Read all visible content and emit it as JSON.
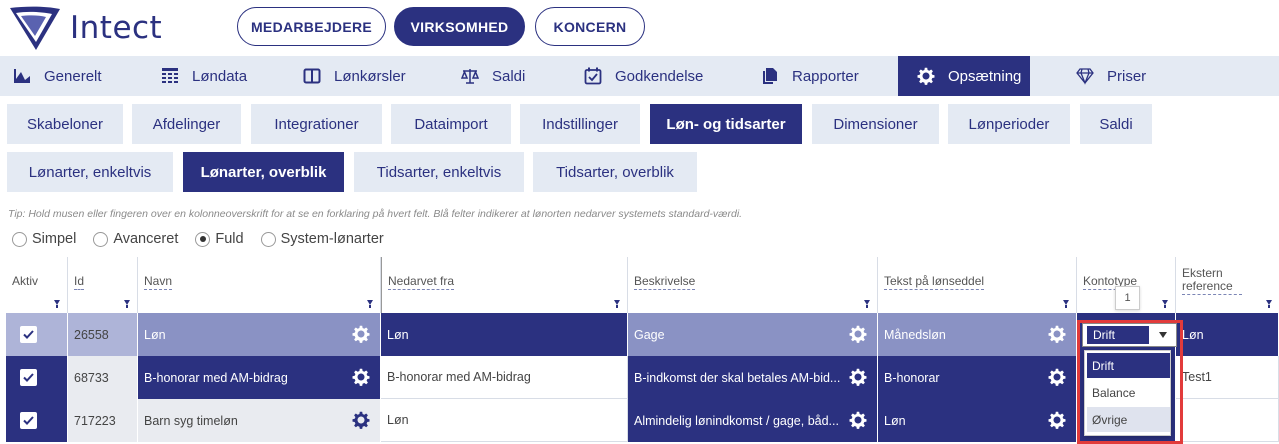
{
  "app": {
    "logo_text": "Intect"
  },
  "scope_tabs": [
    {
      "label": "MEDARBEJDERE",
      "active": false
    },
    {
      "label": "VIRKSOMHED",
      "active": true
    },
    {
      "label": "KONCERN",
      "active": false
    }
  ],
  "main_nav": [
    {
      "label": "Generelt",
      "icon": "chart-icon"
    },
    {
      "label": "Løndata",
      "icon": "grid-icon"
    },
    {
      "label": "Lønkørsler",
      "icon": "window-icon"
    },
    {
      "label": "Saldi",
      "icon": "scale-icon"
    },
    {
      "label": "Godkendelse",
      "icon": "calendar-check-icon"
    },
    {
      "label": "Rapporter",
      "icon": "documents-icon"
    },
    {
      "label": "Opsætning",
      "icon": "gear-icon",
      "active": true
    },
    {
      "label": "Priser",
      "icon": "diamond-icon"
    }
  ],
  "sub_nav": [
    {
      "label": "Skabeloner"
    },
    {
      "label": "Afdelinger"
    },
    {
      "label": "Integrationer"
    },
    {
      "label": "Dataimport"
    },
    {
      "label": "Indstillinger"
    },
    {
      "label": "Løn- og tidsarter",
      "active": true
    },
    {
      "label": "Dimensioner"
    },
    {
      "label": "Lønperioder"
    },
    {
      "label": "Saldi"
    }
  ],
  "sub_nav2": [
    {
      "label": "Lønarter, enkeltvis"
    },
    {
      "label": "Lønarter, overblik",
      "active": true
    },
    {
      "label": "Tidsarter, enkeltvis"
    },
    {
      "label": "Tidsarter, overblik"
    }
  ],
  "tip": "Tip: Hold musen eller fingeren over en kolonneoverskrift for at se en forklaring på hvert felt. Blå felter indikerer at lønorten nedarver systemets standard-værdi.",
  "view_modes": [
    {
      "label": "Simpel",
      "selected": false
    },
    {
      "label": "Avanceret",
      "selected": false
    },
    {
      "label": "Fuld",
      "selected": true
    },
    {
      "label": "System-lønarter",
      "selected": false
    }
  ],
  "grid": {
    "columns": [
      "Aktiv",
      "Id",
      "Navn",
      "Nedarvet fra",
      "Beskrivelse",
      "Tekst på lønseddel",
      "Kontotype",
      "Ekstern reference"
    ],
    "rows": [
      {
        "aktiv": true,
        "id": "26558",
        "navn": "Løn",
        "nedarvet": "Løn",
        "beskrivelse": "Gage",
        "tekst": "Månedsløn",
        "kontotype": "Drift",
        "ekstern": "Løn"
      },
      {
        "aktiv": true,
        "id": "68733",
        "navn": "B-honorar med AM-bidrag",
        "nedarvet": "B-honorar med AM-bidrag",
        "beskrivelse": "B-indkomst der skal betales AM-bid...",
        "tekst": "B-honorar",
        "kontotype": "",
        "ekstern": "Test1"
      },
      {
        "aktiv": true,
        "id": "717223",
        "navn": "Barn syg timeløn",
        "nedarvet": "Løn",
        "beskrivelse": "Almindelig lønindkomst / gage, båd...",
        "tekst": "Løn",
        "kontotype": "",
        "ekstern": ""
      }
    ]
  },
  "tooltip_value": "1",
  "kontotype_select": {
    "value": "Drift",
    "options": [
      "Drift",
      "Balance",
      "Øvrige"
    ]
  },
  "colors": {
    "primary": "#2b3180",
    "nav_bg": "#e4eaf3",
    "highlight": "#e23b3b"
  }
}
